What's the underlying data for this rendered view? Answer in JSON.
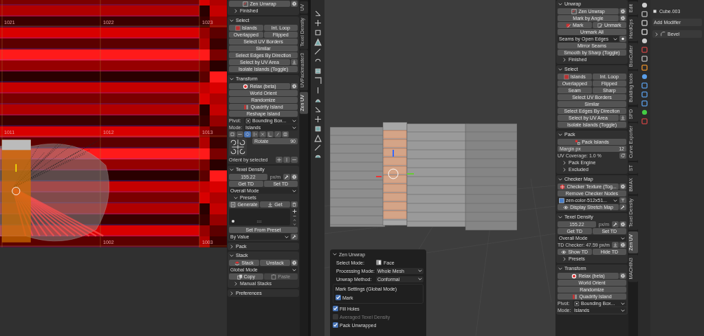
{
  "uv_editor": {
    "tile_rows": [
      [
        "1021",
        "1022",
        "1023"
      ],
      [
        "1011",
        "1012",
        "1013"
      ],
      [
        "1002",
        "1003"
      ]
    ]
  },
  "left_panel": {
    "sections": [
      {
        "rows": [
          {
            "kind": "buttons",
            "items": [
              {
                "label": "Zen Unwrap"
              }
            ]
          },
          {
            "kind": "subheader",
            "title": "Finished",
            "expanded": false
          }
        ]
      },
      {
        "title": "Select",
        "expanded": true,
        "rows": [
          {
            "kind": "buttons",
            "items": [
              {
                "label": "Islands"
              },
              {
                "label": "Int. Loop"
              }
            ]
          },
          {
            "kind": "buttons",
            "items": [
              {
                "label": "Overlapped"
              },
              {
                "label": "Flipped"
              }
            ]
          },
          {
            "kind": "buttons",
            "items": [
              {
                "label": "Select UV Borders"
              }
            ]
          },
          {
            "kind": "buttons",
            "items": [
              {
                "label": "Similar"
              }
            ]
          },
          {
            "kind": "buttons",
            "items": [
              {
                "label": "Select Edges By Direction"
              }
            ]
          },
          {
            "kind": "buttons",
            "items": [
              {
                "label": "Select by UV Area"
              }
            ]
          },
          {
            "kind": "buttons",
            "items": [
              {
                "label": "Isolate Islands (Toggle)"
              }
            ]
          }
        ]
      },
      {
        "title": "Transform",
        "expanded": true,
        "rows": [
          {
            "kind": "buttons",
            "items": [
              {
                "label": "Relax (beta)"
              }
            ]
          },
          {
            "kind": "buttons",
            "items": [
              {
                "label": "World Orient"
              }
            ]
          },
          {
            "kind": "buttons",
            "items": [
              {
                "label": "Randomize"
              }
            ]
          },
          {
            "kind": "buttons",
            "items": [
              {
                "label": "Quadrify Island"
              }
            ]
          },
          {
            "kind": "buttons",
            "items": [
              {
                "label": "Reshape Island"
              }
            ]
          },
          {
            "kind": "dropdown",
            "label": "Pivot:",
            "value": "Bounding Box..."
          },
          {
            "kind": "dropdown",
            "label": "Mode:",
            "value": "Islands"
          },
          {
            "kind": "iconbar",
            "items": [
              {
                "selected": false
              },
              {
                "selected": false
              },
              {
                "selected": true
              },
              {
                "selected": false
              },
              {
                "selected": false
              },
              {
                "selected": false
              },
              {
                "selected": false
              },
              {
                "selected": false
              }
            ]
          },
          {
            "kind": "rotate",
            "label": "Rotate",
            "value": "90"
          },
          {
            "kind": "orient",
            "label": "Orient by selected"
          }
        ]
      },
      {
        "title": "Texel Density",
        "expanded": true,
        "rows": [
          {
            "kind": "field",
            "value": "155.22",
            "unit": "px/m"
          },
          {
            "kind": "buttons",
            "items": [
              {
                "label": "Get TD"
              },
              {
                "label": "Set TD"
              }
            ]
          },
          {
            "kind": "dropdown",
            "value": "Overall Mode"
          },
          {
            "kind": "subheader",
            "title": "Presets",
            "expanded": true
          },
          {
            "kind": "buttons",
            "items": [
              {
                "label": "Generate"
              },
              {
                "label": "Get"
              }
            ]
          },
          {
            "kind": "presets_list"
          },
          {
            "kind": "buttons",
            "items": [
              {
                "label": "Set From Preset"
              }
            ]
          },
          {
            "kind": "dropdown",
            "value": "By Value"
          }
        ]
      },
      {
        "title": "Pack",
        "expanded": false
      },
      {
        "title": "Stack",
        "expanded": true,
        "rows": [
          {
            "kind": "buttons",
            "items": [
              {
                "label": "Stack"
              },
              {
                "label": "Unstack"
              }
            ]
          },
          {
            "kind": "dropdown",
            "value": "Global Mode"
          },
          {
            "kind": "buttons",
            "items": [
              {
                "label": "Copy",
                "disabled": false
              },
              {
                "label": "Paste",
                "disabled": true
              }
            ]
          },
          {
            "kind": "subheader",
            "title": "Manual Stacks",
            "expanded": false
          }
        ]
      },
      {
        "title": "Preferences",
        "expanded": false
      }
    ]
  },
  "left_tabs": [
    {
      "label": "UV",
      "selected": false
    },
    {
      "label": "Texel Density",
      "selected": false
    },
    {
      "label": "UVPackmaster3",
      "selected": false
    },
    {
      "label": "Zen UV",
      "selected": true
    }
  ],
  "popup": {
    "title": "Zen Unwrap",
    "expanded": true,
    "props": [
      {
        "kind": "toggle",
        "label": "Select Mode:",
        "value": "Face"
      },
      {
        "kind": "dropdown",
        "label": "Processing Mode:",
        "value": "Whole Mesh"
      },
      {
        "kind": "dropdown",
        "label": "Unwrap Method:",
        "value": "Conformal"
      }
    ],
    "mark_box": {
      "title": "Mark Settings (Global Mode)",
      "options": [
        {
          "label": "Mark",
          "checked": true,
          "disabled": false
        }
      ]
    },
    "options": [
      {
        "label": "Fill Holes",
        "checked": true,
        "disabled": false
      },
      {
        "label": "Averaged Texel Density",
        "checked": false,
        "disabled": true
      },
      {
        "label": "Pack Unwrapped",
        "checked": true,
        "disabled": false
      }
    ]
  },
  "right_panel": {
    "sections": [
      {
        "title": "Unwrap",
        "expanded": true,
        "rows": [
          {
            "kind": "buttons",
            "items": [
              {
                "label": "Zen Unwrap"
              }
            ]
          },
          {
            "kind": "buttons",
            "items": [
              {
                "label": "Mark by Angle"
              }
            ]
          },
          {
            "kind": "buttons",
            "items": [
              {
                "label": "Mark"
              },
              {
                "label": "Unmark"
              }
            ]
          },
          {
            "kind": "buttons",
            "items": [
              {
                "label": "Unmark All"
              }
            ]
          },
          {
            "kind": "dropdown",
            "value": "Seams by Open Edges"
          },
          {
            "kind": "buttons",
            "items": [
              {
                "label": "Mirror Seams"
              }
            ]
          },
          {
            "kind": "buttons",
            "items": [
              {
                "label": "Smooth by Sharp (Toggle)"
              }
            ]
          },
          {
            "kind": "subheader",
            "title": "Finished",
            "expanded": false
          }
        ]
      },
      {
        "title": "Select",
        "expanded": true,
        "rows": [
          {
            "kind": "buttons",
            "items": [
              {
                "label": "Islands"
              },
              {
                "label": "Int. Loop"
              }
            ]
          },
          {
            "kind": "buttons",
            "items": [
              {
                "label": "Overlapped"
              },
              {
                "label": "Flipped"
              }
            ]
          },
          {
            "kind": "buttons",
            "items": [
              {
                "label": "Seam"
              },
              {
                "label": "Sharp"
              }
            ]
          },
          {
            "kind": "buttons",
            "items": [
              {
                "label": "Select UV Borders"
              }
            ]
          },
          {
            "kind": "buttons",
            "items": [
              {
                "label": "Similar"
              }
            ]
          },
          {
            "kind": "buttons",
            "items": [
              {
                "label": "Select Edges By Direction"
              }
            ]
          },
          {
            "kind": "buttons",
            "items": [
              {
                "label": "Select by UV Area"
              }
            ]
          },
          {
            "kind": "buttons",
            "items": [
              {
                "label": "Isolate Islands (Toggle)"
              }
            ]
          }
        ]
      },
      {
        "title": "Pack",
        "expanded": true,
        "rows": [
          {
            "kind": "buttons",
            "items": [
              {
                "label": "Pack Islands"
              }
            ]
          },
          {
            "kind": "field",
            "label": "Margin px",
            "value": "12"
          },
          {
            "kind": "text",
            "text": "UV Coverage: 1.0 %"
          },
          {
            "kind": "subheader",
            "title": "Pack Engine",
            "expanded": false
          },
          {
            "kind": "subheader",
            "title": "Excluded",
            "expanded": false
          }
        ]
      },
      {
        "title": "Checker Map",
        "expanded": true,
        "rows": [
          {
            "kind": "buttons",
            "items": [
              {
                "label": "Checker Texture (Tog..."
              }
            ]
          },
          {
            "kind": "buttons",
            "items": [
              {
                "label": "Remove Checker Nodes"
              }
            ]
          },
          {
            "kind": "dropdown",
            "value": "zen-color-512x51..."
          },
          {
            "kind": "buttons",
            "items": [
              {
                "label": "Display Stretch Map"
              }
            ]
          }
        ]
      },
      {
        "title": "Texel Density",
        "expanded": true,
        "rows": [
          {
            "kind": "field",
            "value": "155.22",
            "unit": "px/m"
          },
          {
            "kind": "buttons",
            "items": [
              {
                "label": "Get TD"
              },
              {
                "label": "Set TD"
              }
            ]
          },
          {
            "kind": "dropdown",
            "value": "Overall Mode"
          },
          {
            "kind": "text",
            "text": "TD Checker: 47.59 px/m"
          },
          {
            "kind": "buttons",
            "items": [
              {
                "label": "Show TD"
              },
              {
                "label": "Hide TD"
              }
            ]
          },
          {
            "kind": "subheader",
            "title": "Presets",
            "expanded": false
          }
        ]
      },
      {
        "title": "Transform",
        "expanded": true,
        "rows": [
          {
            "kind": "buttons",
            "items": [
              {
                "label": "Relax (beta)"
              }
            ]
          },
          {
            "kind": "buttons",
            "items": [
              {
                "label": "World Orient"
              }
            ]
          },
          {
            "kind": "buttons",
            "items": [
              {
                "label": "Randomize"
              }
            ]
          },
          {
            "kind": "buttons",
            "items": [
              {
                "label": "Quadrify Island"
              }
            ]
          },
          {
            "kind": "dropdown",
            "label": "Pivot:",
            "value": "Bounding Box..."
          },
          {
            "kind": "dropdown",
            "label": "Mode:",
            "value": "Islands"
          }
        ]
      }
    ]
  },
  "right_tabs": [
    {
      "label": "Edit",
      "selected": false
    },
    {
      "label": "HardOps",
      "selected": false
    },
    {
      "label": "BoxCutter",
      "selected": false
    },
    {
      "label": "Building tools",
      "selected": false
    },
    {
      "label": "SPD",
      "selected": false
    },
    {
      "label": "Curve Exporter",
      "selected": false
    },
    {
      "label": "ST",
      "selected": false
    },
    {
      "label": "BMAX",
      "selected": false
    },
    {
      "label": "Texel Density",
      "selected": false
    },
    {
      "label": "Zen UV",
      "selected": true
    },
    {
      "label": "MACHIN3",
      "selected": false
    }
  ],
  "properties": {
    "object": "Cube.003",
    "add_modifier": "Add Modifier",
    "modifiers": [
      {
        "name": "Bevel",
        "expanded": false
      }
    ]
  }
}
